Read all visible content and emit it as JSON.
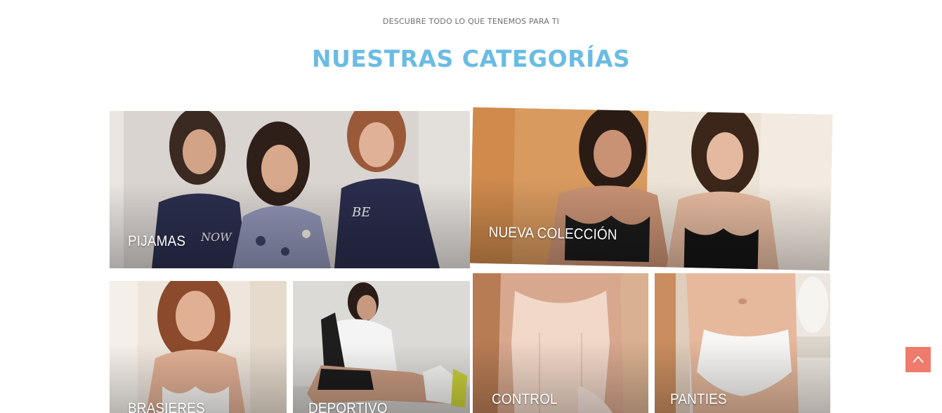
{
  "section": {
    "eyebrow": "DESCUBRE TODO LO QUE TENEMOS PARA TI",
    "title": "NUESTRAS CATEGORÍAS",
    "title_color": "#6bbce3"
  },
  "categories": [
    {
      "label": "PIJAMAS"
    },
    {
      "label": "NUEVA COLECCIÓN"
    },
    {
      "label": "BRASIERES"
    },
    {
      "label": "DEPORTIVO"
    },
    {
      "label": "CONTROL"
    },
    {
      "label": "PANTIES"
    }
  ],
  "scroll_top": {
    "icon": "chevron-up-icon",
    "color": "#ee7b6c"
  }
}
